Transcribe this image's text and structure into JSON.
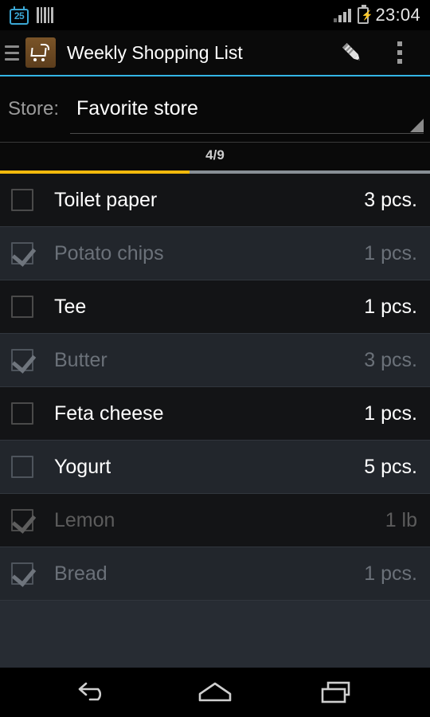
{
  "statusbar": {
    "calendar_day": "25",
    "calendar_icon": "calendar-icon",
    "barcode_icon": "barcode-icon",
    "signal_icon": "signal-bars-icon",
    "battery_icon": "battery-charging-icon",
    "time": "23:04"
  },
  "actionbar": {
    "up_icon": "hamburger-up-icon",
    "app_icon": "shopping-cart-icon",
    "title": "Weekly Shopping List",
    "edit_icon": "pencil-icon",
    "overflow_icon": "overflow-menu-icon",
    "accent_color": "#33b5e5"
  },
  "store": {
    "label": "Store:",
    "selected": "Favorite store",
    "dropdown_icon": "spinner-triangle-icon"
  },
  "progress": {
    "count_text": "4/9",
    "checked": 4,
    "total": 9,
    "percent": 44,
    "fill_color": "#f2b90c",
    "track_color": "#888f96"
  },
  "items": [
    {
      "name": "Toilet paper",
      "qty": "3 pcs.",
      "checked": false
    },
    {
      "name": "Potato chips",
      "qty": "1 pcs.",
      "checked": true
    },
    {
      "name": "Tee",
      "qty": "1 pcs.",
      "checked": false
    },
    {
      "name": "Butter",
      "qty": "3 pcs.",
      "checked": true
    },
    {
      "name": "Feta cheese",
      "qty": "1 pcs.",
      "checked": false
    },
    {
      "name": "Yogurt",
      "qty": "5 pcs.",
      "checked": false
    },
    {
      "name": "Lemon",
      "qty": "1 lb",
      "checked": true
    },
    {
      "name": "Bread",
      "qty": "1 pcs.",
      "checked": true
    }
  ],
  "navbar": {
    "back_icon": "back-arrow-icon",
    "home_icon": "home-icon",
    "recents_icon": "recents-icon"
  }
}
